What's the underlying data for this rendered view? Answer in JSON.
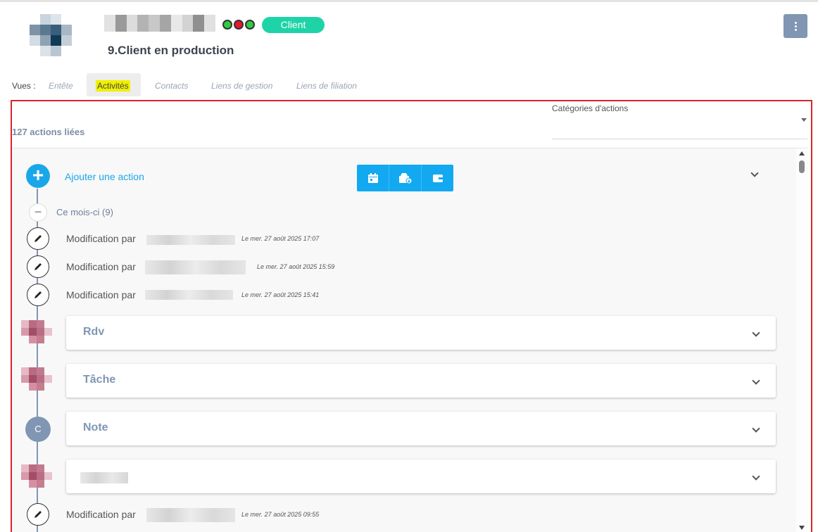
{
  "header": {
    "badge": "Client",
    "status_title": "9.Client en production",
    "dot_colors": [
      "#2ecc40",
      "#e8182b",
      "#2ecc40"
    ],
    "badge_color": "#1fd3a8"
  },
  "views": {
    "label": "Vues :",
    "tabs": [
      {
        "label": "Entête",
        "active": false
      },
      {
        "label": "Activités",
        "active": true
      },
      {
        "label": "Contacts",
        "active": false
      },
      {
        "label": "Liens de gestion",
        "active": false
      },
      {
        "label": "Liens de filiation",
        "active": false
      }
    ]
  },
  "activity": {
    "count_label": "127 actions liées",
    "category_filter_label": "Catégories d'actions",
    "add_action_label": "Ajouter une action",
    "quick_buttons": [
      "calendar-icon",
      "inbox-download-icon",
      "wallet-icon"
    ],
    "month_group": "Ce mois-ci (9)",
    "modifications": [
      {
        "label": "Modification par",
        "date": "Le mer. 27 août 2025 17:07"
      },
      {
        "label": "Modification par",
        "date": "Le mer. 27 août 2025 15:59"
      },
      {
        "label": "Modification par",
        "date": "Le mer. 27 août 2025 15:41"
      },
      {
        "label": "Modification par",
        "date": "Le mer. 27 août 2025 09:55"
      }
    ],
    "cards": [
      {
        "title": "Rdv"
      },
      {
        "title": "Tâche"
      },
      {
        "title": "Note",
        "avatar_letter": "C"
      },
      {
        "title": ""
      }
    ]
  }
}
